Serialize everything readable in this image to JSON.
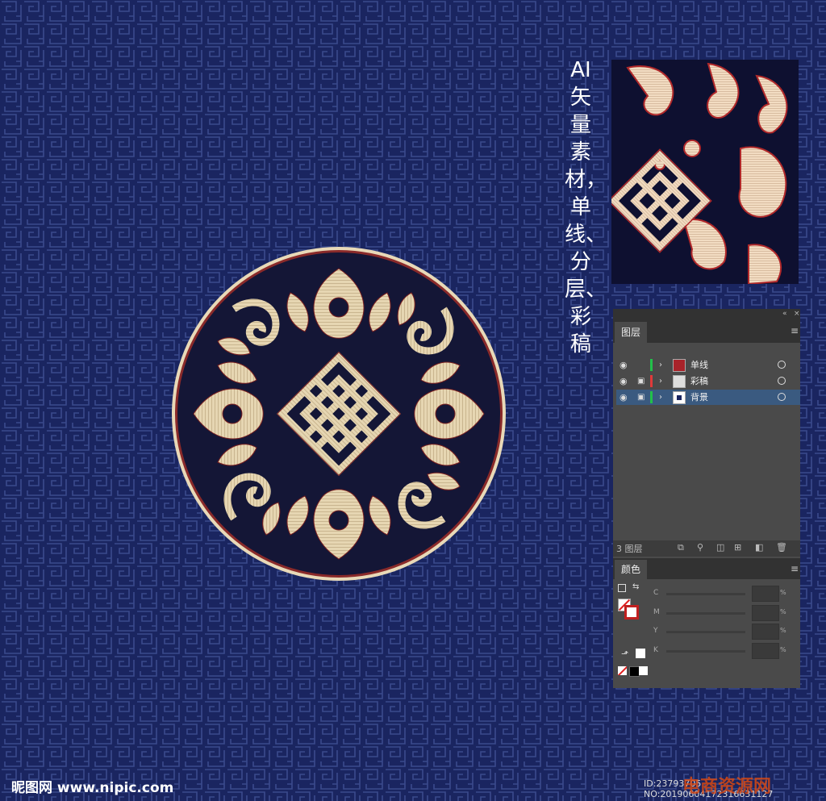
{
  "title_vertical": "AI矢量素材，单线、分层、彩稿",
  "layers_panel": {
    "tab_label": "图层",
    "menu_icon": "hamburger-menu-icon",
    "layers": [
      {
        "name": "单线",
        "color": "#22c04a",
        "locked": false,
        "selected": false
      },
      {
        "name": "彩稿",
        "color": "#e03a3a",
        "locked": true,
        "selected": false
      },
      {
        "name": "背景",
        "color": "#22c04a",
        "locked": true,
        "selected": true
      }
    ],
    "footer_count": "3 图层"
  },
  "color_panel": {
    "tab_label": "颜色",
    "channels": [
      "C",
      "M",
      "Y",
      "K"
    ],
    "percent_symbol": "%"
  },
  "footer": {
    "site_logo": "昵图网 www.nipic.com",
    "id_text": "ID:23793705 NO:20190604172316631127",
    "watermark": "电商资源网"
  },
  "colors": {
    "background": "#1a2560",
    "medallion_gold": "#e6d6b2",
    "medallion_dark": "#141636",
    "accent_red": "#a8232a"
  }
}
